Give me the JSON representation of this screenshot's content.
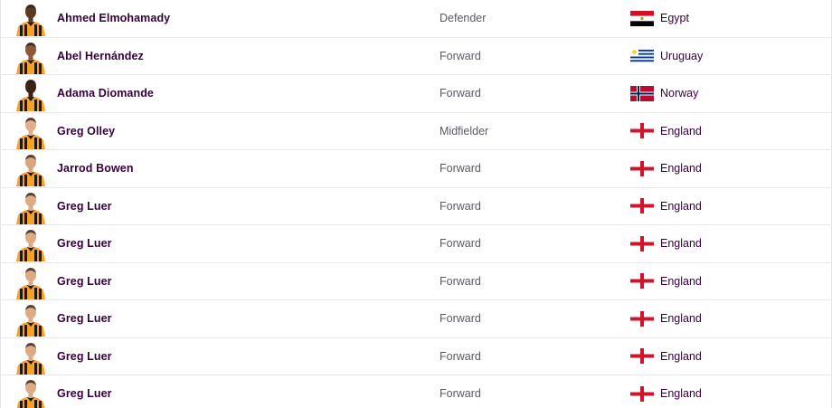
{
  "players": [
    {
      "name": "Ahmed Elmohamady",
      "position": "Defender",
      "nationality": "Egypt",
      "flag": "egypt-flag",
      "skin": "#5b3a22"
    },
    {
      "name": "Abel Hernández",
      "position": "Forward",
      "nationality": "Uruguay",
      "flag": "uruguay-flag",
      "skin": "#8a5a3a"
    },
    {
      "name": "Adama Diomande",
      "position": "Forward",
      "nationality": "Norway",
      "flag": "norway-flag",
      "skin": "#3b2416"
    },
    {
      "name": "Greg Olley",
      "position": "Midfielder",
      "nationality": "England",
      "flag": "england-flag",
      "skin": "#e0b08a"
    },
    {
      "name": "Jarrod Bowen",
      "position": "Forward",
      "nationality": "England",
      "flag": "england-flag",
      "skin": "#d9a47e"
    },
    {
      "name": "Greg Luer",
      "position": "Forward",
      "nationality": "England",
      "flag": "england-flag",
      "skin": "#dcaa84"
    },
    {
      "name": "Greg Luer",
      "position": "Forward",
      "nationality": "England",
      "flag": "england-flag",
      "skin": "#dcaa84"
    },
    {
      "name": "Greg Luer",
      "position": "Forward",
      "nationality": "England",
      "flag": "england-flag",
      "skin": "#dcaa84"
    },
    {
      "name": "Greg Luer",
      "position": "Forward",
      "nationality": "England",
      "flag": "england-flag",
      "skin": "#dcaa84"
    },
    {
      "name": "Greg Luer",
      "position": "Forward",
      "nationality": "England",
      "flag": "england-flag",
      "skin": "#dcaa84"
    },
    {
      "name": "Greg Luer",
      "position": "Forward",
      "nationality": "England",
      "flag": "england-flag",
      "skin": "#dcaa84"
    }
  ],
  "colors": {
    "kit_amber": "#f5a12a",
    "kit_black": "#1a1a1a",
    "name_text": "#37003c",
    "divider": "#e8e8ec"
  }
}
